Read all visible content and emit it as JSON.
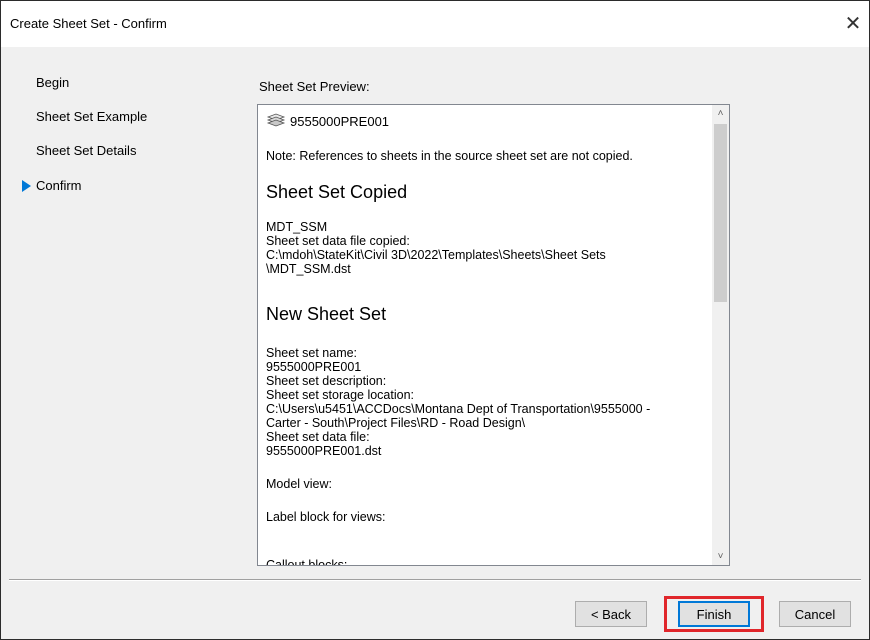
{
  "window": {
    "title": "Create Sheet Set - Confirm",
    "close_glyph": "✕"
  },
  "steps": [
    {
      "label": "Begin",
      "current": false
    },
    {
      "label": "Sheet Set Example",
      "current": false
    },
    {
      "label": "Sheet Set Details",
      "current": false
    },
    {
      "label": "Confirm",
      "current": true
    }
  ],
  "preview": {
    "label": "Sheet Set Preview:",
    "sheet_set_name": "9555000PRE001",
    "note": "Note: References to sheets in the source sheet set are not copied.",
    "copied": {
      "heading": "Sheet Set Copied",
      "source_name": "MDT_SSM",
      "data_file_label": "Sheet set data file copied:",
      "data_file_path_line1": "C:\\mdoh\\StateKit\\Civil 3D\\2022\\Templates\\Sheets\\Sheet Sets",
      "data_file_path_line2": "\\MDT_SSM.dst"
    },
    "new_set": {
      "heading": "New Sheet Set",
      "name_label": "Sheet set name:",
      "name_value": "9555000PRE001",
      "description_label": "Sheet set description:",
      "storage_label": "Sheet set storage location:",
      "storage_line1": "C:\\Users\\u5451\\ACCDocs\\Montana Dept of Transportation\\9555000 -",
      "storage_line2": "Carter - South\\Project Files\\RD - Road Design\\",
      "data_file_label": "Sheet set data file:",
      "data_file_value": "9555000PRE001.dst",
      "model_view_label": "Model view:",
      "label_block_label": "Label block for views:",
      "callout_label": "Callout blocks:"
    }
  },
  "buttons": {
    "back": "< Back",
    "finish": "Finish",
    "cancel": "Cancel"
  },
  "colors": {
    "link": "#1a5aa8",
    "accent": "#0078d7",
    "highlight": "#e0262b"
  }
}
